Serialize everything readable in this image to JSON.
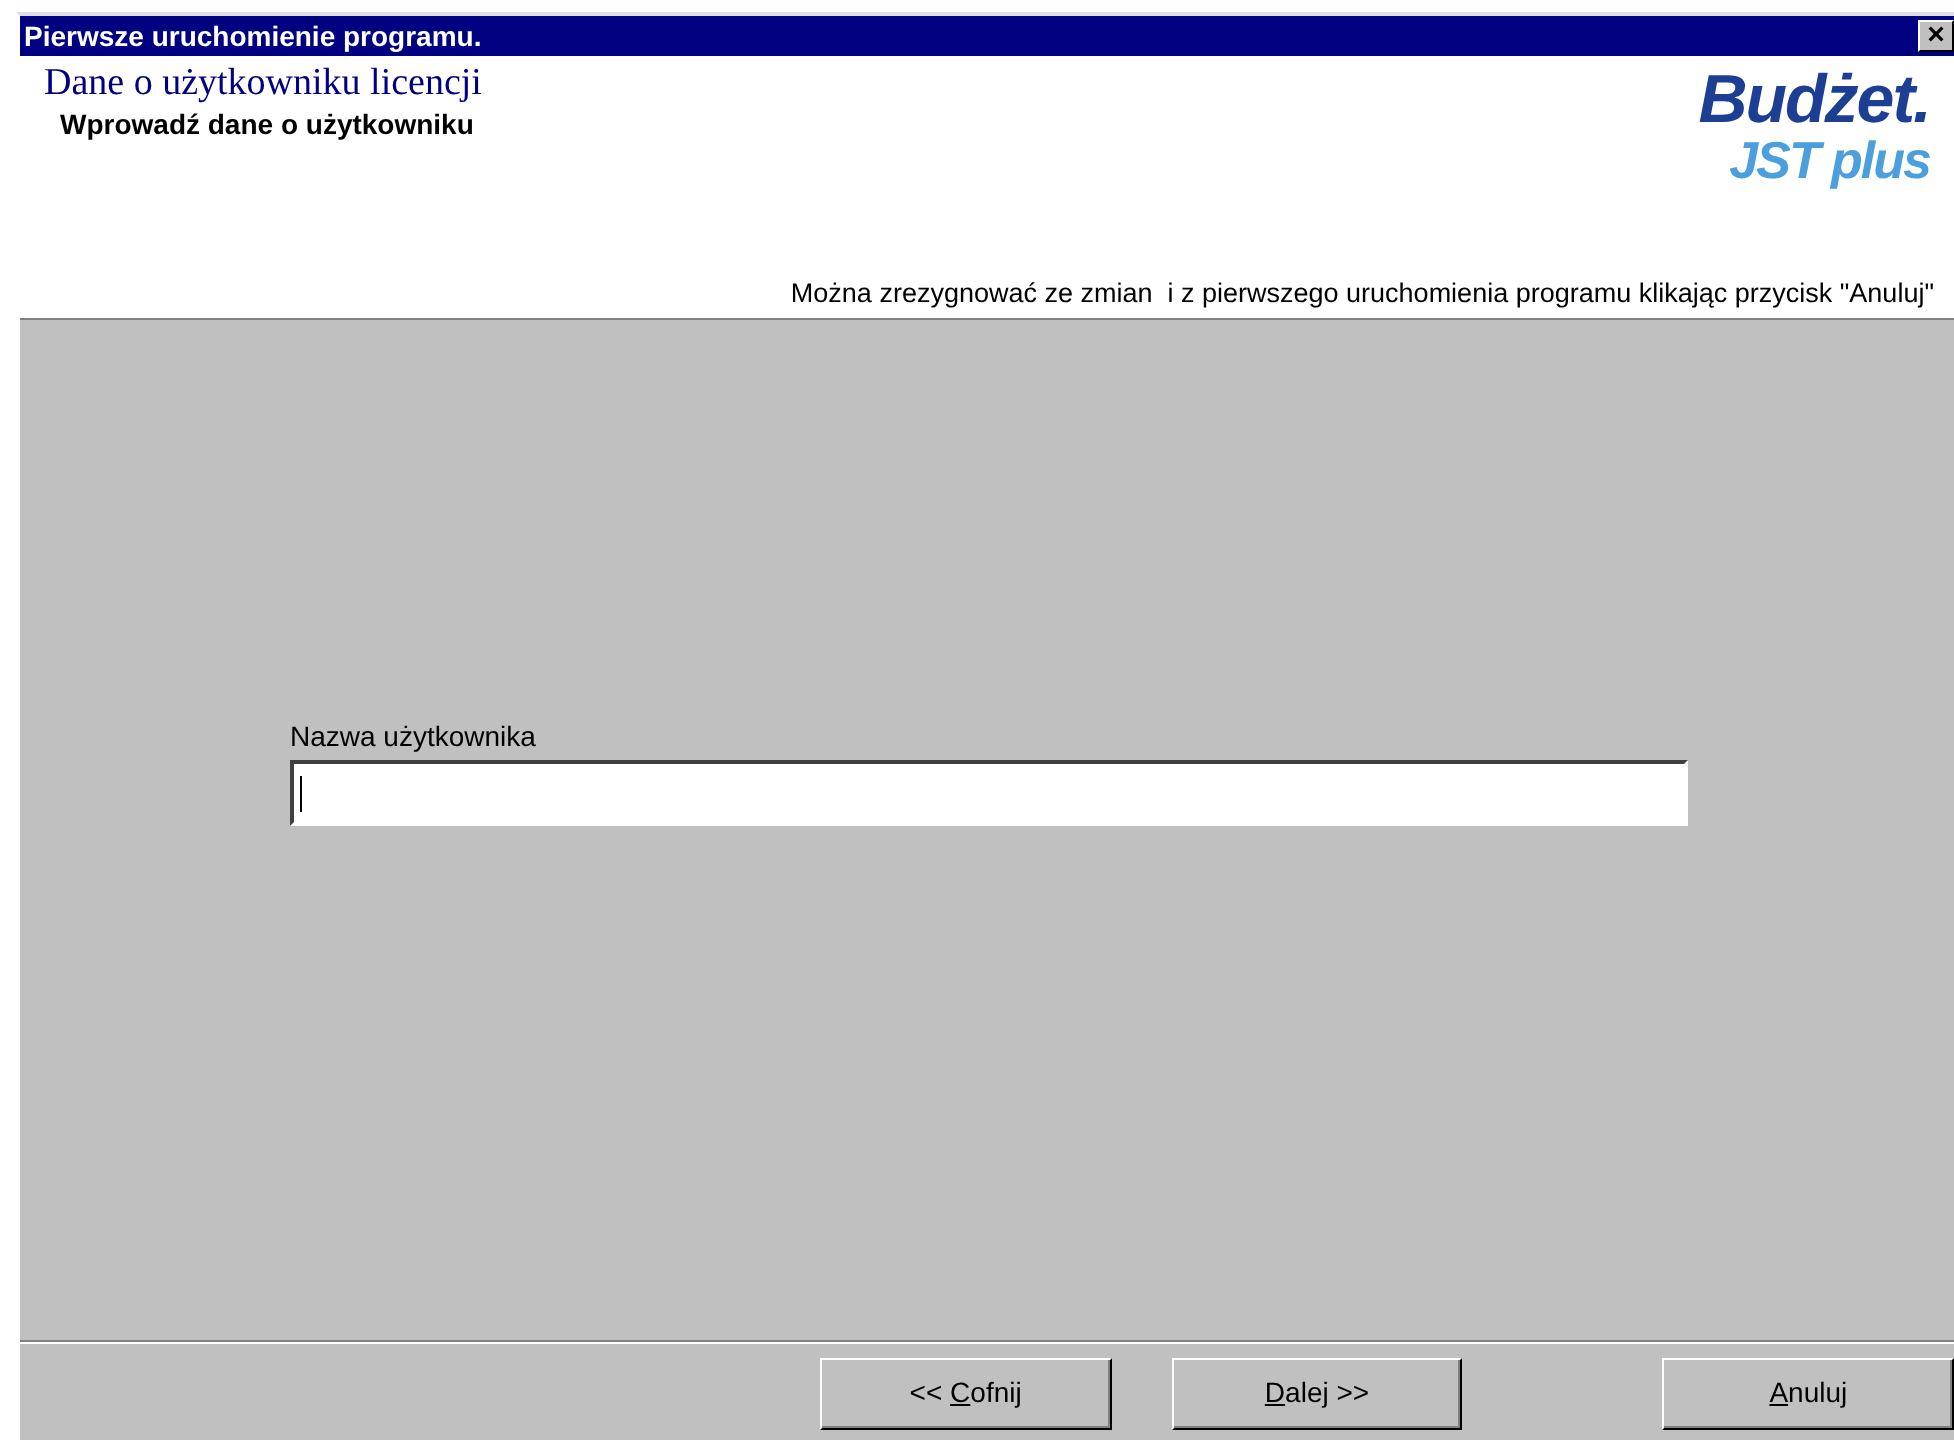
{
  "window": {
    "title": "Pierwsze uruchomienie programu.",
    "close": "×"
  },
  "header": {
    "title": "Dane o użytkowniku licencji",
    "subtitle": "Wprowadź dane o użytkowniku",
    "logo": {
      "main": "Budżet",
      "dot": ".",
      "sub": "JST plus"
    },
    "note": "Można zrezygnować ze zmian  i z pierwszego uruchomienia programu klikając przycisk \"Anuluj\""
  },
  "form": {
    "label": "Nazwa użytkownika",
    "focused": true
  },
  "buttons": [
    {
      "prefix": "<< ",
      "accel": "C",
      "rest": "ofnij"
    },
    {
      "accel": "D",
      "rest": "alej >>"
    },
    {
      "accel": "A",
      "rest": "nuluj"
    }
  ]
}
